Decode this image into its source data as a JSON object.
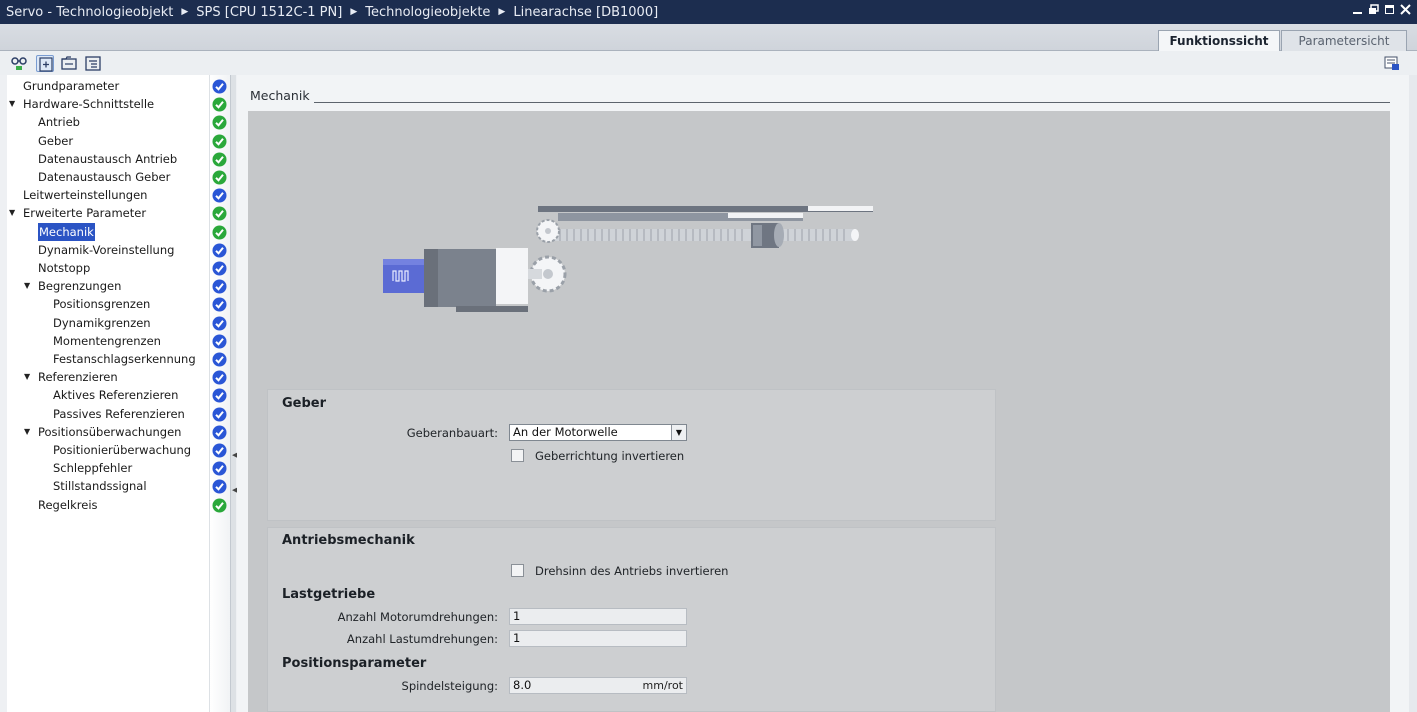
{
  "titlebar": {
    "crumbs": [
      "Servo - Technologieobjekt",
      "SPS [CPU 1512C-1 PN]",
      "Technologieobjekte",
      "Linearachse [DB1000]"
    ],
    "separator": "▶"
  },
  "tabs": {
    "function_view": "Funktionssicht",
    "parameter_view": "Parametersicht"
  },
  "tree": [
    {
      "label": "Grundparameter",
      "level": 0,
      "expandable": false,
      "status": "blue"
    },
    {
      "label": "Hardware-Schnittstelle",
      "level": 0,
      "expandable": true,
      "status": "green"
    },
    {
      "label": "Antrieb",
      "level": 1,
      "expandable": false,
      "status": "green"
    },
    {
      "label": "Geber",
      "level": 1,
      "expandable": false,
      "status": "green"
    },
    {
      "label": "Datenaustausch Antrieb",
      "level": 1,
      "expandable": false,
      "status": "green"
    },
    {
      "label": "Datenaustausch Geber",
      "level": 1,
      "expandable": false,
      "status": "green"
    },
    {
      "label": "Leitwerteinstellungen",
      "level": 0,
      "expandable": false,
      "status": "blue"
    },
    {
      "label": "Erweiterte Parameter",
      "level": 0,
      "expandable": true,
      "status": "green"
    },
    {
      "label": "Mechanik",
      "level": 1,
      "expandable": false,
      "status": "green",
      "selected": true
    },
    {
      "label": "Dynamik-Voreinstellung",
      "level": 1,
      "expandable": false,
      "status": "blue"
    },
    {
      "label": "Notstopp",
      "level": 1,
      "expandable": false,
      "status": "blue"
    },
    {
      "label": "Begrenzungen",
      "level": 1,
      "expandable": true,
      "status": "blue"
    },
    {
      "label": "Positionsgrenzen",
      "level": 2,
      "expandable": false,
      "status": "blue"
    },
    {
      "label": "Dynamikgrenzen",
      "level": 2,
      "expandable": false,
      "status": "blue"
    },
    {
      "label": "Momentengrenzen",
      "level": 2,
      "expandable": false,
      "status": "blue"
    },
    {
      "label": "Festanschlagserkennung",
      "level": 2,
      "expandable": false,
      "status": "blue"
    },
    {
      "label": "Referenzieren",
      "level": 1,
      "expandable": true,
      "status": "blue"
    },
    {
      "label": "Aktives Referenzieren",
      "level": 2,
      "expandable": false,
      "status": "blue"
    },
    {
      "label": "Passives Referenzieren",
      "level": 2,
      "expandable": false,
      "status": "blue"
    },
    {
      "label": "Positionsüberwachungen",
      "level": 1,
      "expandable": true,
      "status": "blue"
    },
    {
      "label": "Positionierüberwachung",
      "level": 2,
      "expandable": false,
      "status": "blue"
    },
    {
      "label": "Schleppfehler",
      "level": 2,
      "expandable": false,
      "status": "blue"
    },
    {
      "label": "Stillstandssignal",
      "level": 2,
      "expandable": false,
      "status": "blue"
    },
    {
      "label": "Regelkreis",
      "level": 1,
      "expandable": false,
      "status": "green"
    }
  ],
  "colors": {
    "status_green": "#2aa83a",
    "status_blue": "#2a56d6",
    "selection": "#2b54c4",
    "titlebar": "#1c2d4f"
  },
  "main": {
    "section_title": "Mechanik",
    "geber": {
      "title": "Geber",
      "mount_label": "Geberanbauart:",
      "mount_value": "An der Motorwelle",
      "invert_label": "Geberrichtung invertieren",
      "invert_checked": false
    },
    "antrieb": {
      "title": "Antriebsmechanik",
      "invert_label": "Drehsinn des Antriebs invertieren",
      "invert_checked": false,
      "gear_title": "Lastgetriebe",
      "motor_rev_label": "Anzahl Motorumdrehungen:",
      "motor_rev_value": "1",
      "load_rev_label": "Anzahl Lastumdrehungen:",
      "load_rev_value": "1",
      "pos_title": "Positionsparameter",
      "pitch_label": "Spindelsteigung:",
      "pitch_value": "8.0",
      "pitch_unit": "mm/rot"
    }
  },
  "icons": {
    "toolbar": [
      "glasses-icon",
      "expand-all-icon",
      "folder-tree-icon",
      "list-tree-icon"
    ],
    "window": [
      "minimize-icon",
      "restore-icon",
      "maximize-icon",
      "close-icon"
    ]
  }
}
